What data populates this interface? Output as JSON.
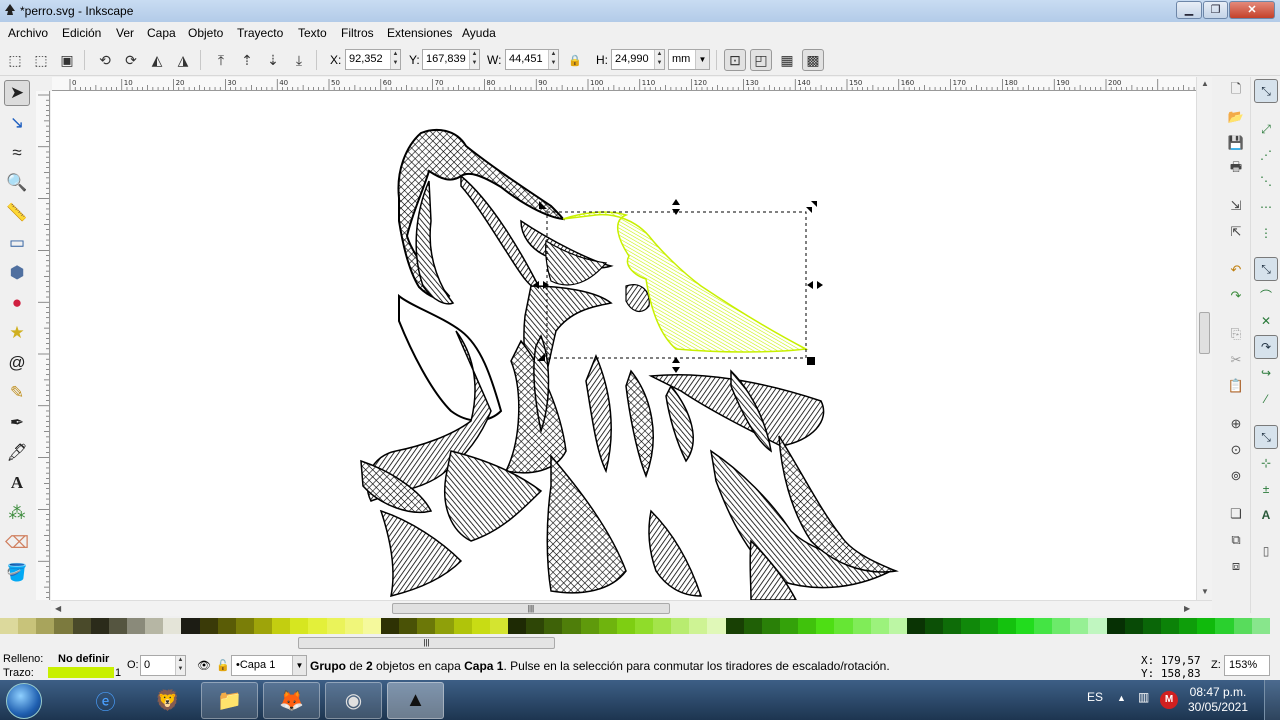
{
  "window": {
    "title": "*perro.svg - Inkscape",
    "min_glyph": "▁",
    "max_glyph": "❐",
    "close_glyph": "✕"
  },
  "menu": [
    {
      "label": "Archivo"
    },
    {
      "label": "Edición"
    },
    {
      "label": "Ver"
    },
    {
      "label": "Capa"
    },
    {
      "label": "Objeto"
    },
    {
      "label": "Trayecto"
    },
    {
      "label": "Texto"
    },
    {
      "label": "Filtros"
    },
    {
      "label": "Extensiones"
    },
    {
      "label": "Ayuda"
    }
  ],
  "controls": {
    "x_label": "X:",
    "x_value": "92,352",
    "y_label": "Y:",
    "y_value": "167,839",
    "w_label": "W:",
    "w_value": "44,451",
    "h_label": "H:",
    "h_value": "24,990",
    "unit": "mm"
  },
  "ruler": {
    "top_ticks": [
      "0",
      "10",
      "20",
      "30",
      "40",
      "50",
      "60",
      "70",
      "80",
      "90",
      "100",
      "110",
      "120",
      "130",
      "140",
      "150",
      "160",
      "170",
      "180",
      "190",
      "200"
    ]
  },
  "palette_colors": [
    "#dcd99c",
    "#c8c37a",
    "#a8a45c",
    "#7c7a3e",
    "#4a4a2a",
    "#2b2b1a",
    "#555540",
    "#8a8a7a",
    "#b6b6a4",
    "#e4e4d8",
    "#1c1c14",
    "#3a3a08",
    "#5a5c06",
    "#7a7e08",
    "#9ea40a",
    "#c3ce10",
    "#d6e620",
    "#e3f03a",
    "#eaf35a",
    "#f0f67a",
    "#f5f99c",
    "#2e3204",
    "#4a5206",
    "#6c7808",
    "#8fa00a",
    "#b0c40a",
    "#c8dc14",
    "#d4e430",
    "#1e2a04",
    "#2e4606",
    "#3e6208",
    "#4f7e0a",
    "#5f9a0c",
    "#6fb40e",
    "#7ece12",
    "#90dc2a",
    "#a4e44a",
    "#b8ec70",
    "#cef394",
    "#e0f8b8",
    "#184004",
    "#206006",
    "#2a8008",
    "#34a20a",
    "#40c20c",
    "#4ede14",
    "#66e634",
    "#80ec58",
    "#9cf27c",
    "#bcf6a4",
    "#0a3404",
    "#0c5006",
    "#0e6c08",
    "#10880a",
    "#12a40c",
    "#14c20e",
    "#22dc1e",
    "#44e444",
    "#6cea6a",
    "#96f094",
    "#c0f6c0",
    "#063004",
    "#084a06",
    "#0a6608",
    "#0c8208",
    "#0e9e0a",
    "#10ba0c",
    "#2ad02e",
    "#58dc5c",
    "#88e68c"
  ],
  "status": {
    "fill_label": "Relleno:",
    "fill_value": "No definir",
    "stroke_label": "Trazo:",
    "stroke_width": "1",
    "stroke_color": "#c8f000",
    "opacity_label": "O:",
    "opacity_value": "0",
    "layer": "•Capa 1",
    "message_prefix": "Grupo",
    "message_part1": " de ",
    "message_count": "2",
    "message_part2": " objetos en capa ",
    "message_layer": "Capa 1",
    "message_part3": ". Pulse en la selección para conmutar los tiradores de escalado/rotación.",
    "cursor_x": "X:  179,57",
    "cursor_y": "Y:  158,83",
    "zoom_label": "Z:",
    "zoom_value": "153%"
  },
  "taskbar": {
    "language": "ES",
    "time": "08:47 p.m.",
    "date": "30/05/2021"
  }
}
